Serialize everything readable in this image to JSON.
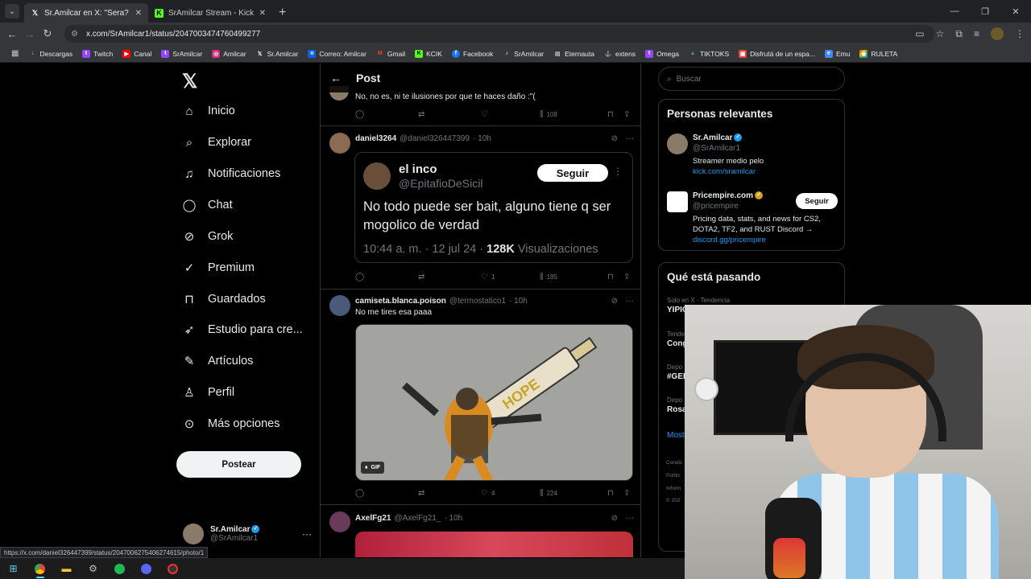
{
  "browser": {
    "tabs": [
      {
        "title": "Sr.Amilcar en X: \"Sera? https://t",
        "icon": "x-logo",
        "active": true
      },
      {
        "title": "SrAmilcar Stream - Kick Dashbo",
        "icon": "kick-logo",
        "active": false
      }
    ],
    "url": "x.com/SrAmilcar1/status/2047003474760499277",
    "bookmarks": [
      {
        "label": "Descargas",
        "icon": "download-icon",
        "color": "#bdc1c6"
      },
      {
        "label": "Twitch",
        "icon": "twitch-icon",
        "color": "#9146ff"
      },
      {
        "label": "Canal",
        "icon": "youtube-icon",
        "color": "#ff0000"
      },
      {
        "label": "SrAmilcar",
        "icon": "twitch-icon",
        "color": "#9146ff"
      },
      {
        "label": "Amilcar",
        "icon": "instagram-icon",
        "color": "#d62976"
      },
      {
        "label": "Sr.Amilcar",
        "icon": "x-icon",
        "color": "#e7e9ea"
      },
      {
        "label": "Correo: Amilcar",
        "icon": "outlook-icon",
        "color": "#0a64d8"
      },
      {
        "label": "Gmail",
        "icon": "gmail-icon",
        "color": "#ea4335"
      },
      {
        "label": "KCIK",
        "icon": "kick-icon",
        "color": "#53fc18"
      },
      {
        "label": "Facebook",
        "icon": "facebook-icon",
        "color": "#1877f2"
      },
      {
        "label": "SrAmilcar",
        "icon": "tiktok-icon",
        "color": "#e7e9ea"
      },
      {
        "label": "Eternauta",
        "icon": "page-icon",
        "color": "#bdc1c6"
      },
      {
        "label": "extens",
        "icon": "globe-icon",
        "color": "#bdc1c6"
      },
      {
        "label": "Omega",
        "icon": "twitch-icon",
        "color": "#9146ff"
      },
      {
        "label": "TIKTOKS",
        "icon": "drive-icon",
        "color": "#34a853"
      },
      {
        "label": "Disfrutá de un espa...",
        "icon": "folder-icon",
        "color": "#ea4335"
      },
      {
        "label": "Emu",
        "icon": "emu-icon",
        "color": "#4285f4"
      },
      {
        "label": "RULETA",
        "icon": "ruleta-icon",
        "color": "#f4b400"
      }
    ]
  },
  "nav": {
    "items": [
      {
        "label": "Inicio",
        "icon": "home-icon"
      },
      {
        "label": "Explorar",
        "icon": "search-icon"
      },
      {
        "label": "Notificaciones",
        "icon": "bell-icon"
      },
      {
        "label": "Chat",
        "icon": "chat-icon"
      },
      {
        "label": "Grok",
        "icon": "grok-icon"
      },
      {
        "label": "Premium",
        "icon": "premium-icon"
      },
      {
        "label": "Guardados",
        "icon": "bookmark-icon"
      },
      {
        "label": "Estudio para cre...",
        "icon": "rocket-icon"
      },
      {
        "label": "Artículos",
        "icon": "article-icon"
      },
      {
        "label": "Perfil",
        "icon": "profile-icon"
      },
      {
        "label": "Más opciones",
        "icon": "more-icon"
      }
    ],
    "post_button": "Postear",
    "account": {
      "name": "Sr.Amilcar",
      "handle": "@SrAmilcar1"
    }
  },
  "timeline": {
    "header": "Post",
    "reply0": {
      "text": "No, no es, ni te ilusiones por que te haces daño :\"(",
      "views": "108"
    },
    "reply1": {
      "name": "daniel3264",
      "handle": "@daniel326447399",
      "time": "· 10h",
      "embed": {
        "name": "el inco",
        "handle": "@EpitafioDeSicil",
        "follow": "Seguir",
        "text": "No todo puede ser bait, alguno tiene q ser mogolico de verdad",
        "meta_date": "10:44 a. m. · 12 jul 24 · ",
        "meta_views": "128K",
        "meta_suffix": " Visualizaciones"
      },
      "likes": "1",
      "views": "185"
    },
    "reply2": {
      "name": "camiseta.blanca.poison",
      "handle": "@termostatico1",
      "time": "· 10h",
      "text": "No me tires esa paaa",
      "gif_label": "GIF",
      "gif_text": "HOPE",
      "likes": "4",
      "views": "224"
    },
    "reply3": {
      "name": "AxelFg21",
      "handle": "@AxelFg21_",
      "time": "· 10h"
    }
  },
  "right": {
    "search_placeholder": "Buscar",
    "relevant_title": "Personas relevantes",
    "people": [
      {
        "name": "Sr.Amilcar",
        "handle": "@SrAmilcar1",
        "bio": "Streamer medio pelo",
        "link": "kick.com/sramilcar"
      },
      {
        "name": "Pricempire.com",
        "handle": "@pricempire",
        "bio": "Pricing data, stats, and news for CS2, DOTA2, TF2, and RUST Discord →",
        "link": "discord.gg/pricempire",
        "follow": "Seguir"
      }
    ],
    "trends_title": "Qué está pasando",
    "trends": [
      {
        "context": "Solo en X · Tendencia",
        "name": "YIPIO"
      },
      {
        "context": "Tende",
        "name": "Cong"
      },
      {
        "context": "Depo",
        "name": "#GEI"
      },
      {
        "context": "Depo",
        "name": "Rosa"
      }
    ],
    "show_more": "Most",
    "footer": [
      "Condic",
      "Polític",
      "Inform",
      "© 202"
    ]
  },
  "status_url": "https://x.com/daniel326447399/status/2047006275406274615/photo/1",
  "colors": {
    "accent": "#1d9bf0",
    "bg": "#000000",
    "border": "#2f3336",
    "muted": "#71767b"
  }
}
